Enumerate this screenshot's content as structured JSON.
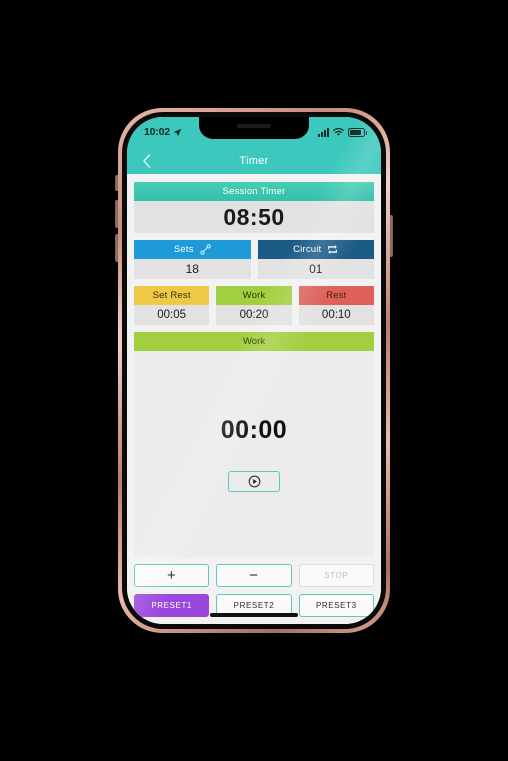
{
  "status_bar": {
    "time": "10:02",
    "location_icon": "location-arrow-icon",
    "signal_icon": "cellular-signal-icon",
    "wifi_icon": "wifi-icon",
    "battery_icon": "battery-icon"
  },
  "nav": {
    "back_icon": "chevron-left-icon",
    "title": "Timer"
  },
  "session": {
    "label": "Session Timer",
    "value": "08:50",
    "header_color": "#3cc8bc",
    "value_bg": "#e2e2e2"
  },
  "counters": [
    {
      "label": "Sets",
      "value": "18",
      "icon": "link-chain-icon",
      "color": "#1e9ad9"
    },
    {
      "label": "Circuit",
      "value": "01",
      "icon": "repeat-loop-icon",
      "color": "#1b5a85"
    }
  ],
  "intervals": [
    {
      "label": "Set Rest",
      "value": "00:05",
      "color": "#eec847"
    },
    {
      "label": "Work",
      "value": "00:20",
      "color": "#a2cf3f"
    },
    {
      "label": "Rest",
      "value": "00:10",
      "color": "#dd615a"
    }
  ],
  "active": {
    "phase_label": "Work",
    "phase_color": "#a2cf3f",
    "time": "00:00",
    "play_icon": "play-circle-icon"
  },
  "controls": {
    "increment_label": "+",
    "decrement_label": "−",
    "stop_label": "STOP",
    "stop_disabled": true,
    "presets": [
      {
        "label": "PRESET1",
        "selected": true,
        "color": "#9a47de"
      },
      {
        "label": "PRESET2",
        "selected": false,
        "color": "#5ec8c0"
      },
      {
        "label": "PRESET3",
        "selected": false,
        "color": "#5ec8c0"
      }
    ]
  },
  "theme": {
    "accent_teal": "#3cc8bc",
    "screen_bg": "#f2f2f2",
    "panel_bg": "#e2e2e2",
    "frame_color": "#c98d7c"
  }
}
